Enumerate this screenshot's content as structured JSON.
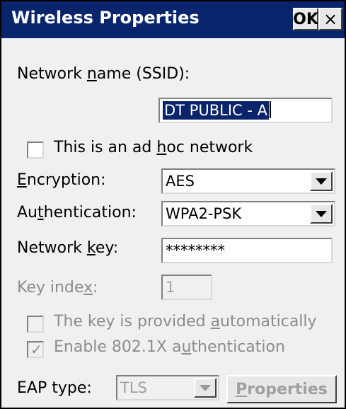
{
  "window": {
    "title": "Wireless Properties",
    "ok_label": "OK",
    "close_label": "×"
  },
  "network_name": {
    "label_pre": "Network ",
    "label_accel": "n",
    "label_post": "ame (SSID):",
    "value": "DT PUBLIC - A"
  },
  "adhoc": {
    "label_pre": "This is an ad ",
    "label_accel": "h",
    "label_post": "oc network",
    "checked": false
  },
  "encryption": {
    "label_accel": "E",
    "label_post": "ncryption:",
    "value": "AES"
  },
  "authentication": {
    "label_pre": "Au",
    "label_accel": "t",
    "label_post": "hentication:",
    "value": "WPA2-PSK"
  },
  "network_key": {
    "label_pre": "Network ",
    "label_accel": "k",
    "label_post": "ey:",
    "value": "********"
  },
  "key_index": {
    "label_pre": "Key inde",
    "label_accel": "x",
    "label_post": ":",
    "value": "1"
  },
  "auto_key": {
    "label_pre": "The key is provided ",
    "label_accel": "a",
    "label_post": "utomatically",
    "checked": false
  },
  "enable_8021x": {
    "label_pre": "Enable 802.1X a",
    "label_accel": "u",
    "label_post": "thentication",
    "checked": true,
    "check_glyph": "✓"
  },
  "eap": {
    "label": "EAP type:",
    "value": "TLS",
    "properties_accel": "P",
    "properties_post": "roperties"
  },
  "colors": {
    "titlebar": "#08246b",
    "selection": "#0a246a",
    "dialog_bg": "#f0f0f0",
    "disabled_text": "#8c8c8c"
  }
}
